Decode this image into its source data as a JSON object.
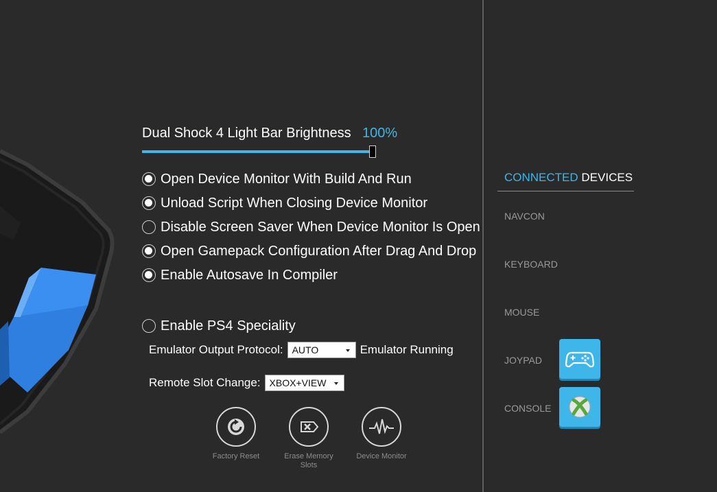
{
  "settings": {
    "brightness_label": "Dual Shock 4 Light Bar Brightness",
    "brightness_value": "100%",
    "brightness_percent": 100,
    "options": [
      {
        "label": "Open Device Monitor With Build And Run",
        "checked": true
      },
      {
        "label": "Unload Script When Closing Device Monitor",
        "checked": true
      },
      {
        "label": "Disable Screen Saver When Device Monitor Is Open",
        "checked": false
      },
      {
        "label": "Open Gamepack Configuration After Drag And Drop",
        "checked": true
      },
      {
        "label": "Enable Autosave In Compiler",
        "checked": true
      }
    ],
    "ps4_speciality": {
      "label": "Enable PS4 Speciality",
      "checked": false
    },
    "emulator_output": {
      "label": "Emulator Output Protocol:",
      "value": "AUTO",
      "status": "Emulator Running"
    },
    "remote_slot": {
      "label": "Remote Slot Change:",
      "value": "XBOX+VIEW"
    }
  },
  "actions": [
    {
      "label": "Factory Reset",
      "icon": "factory-reset-icon"
    },
    {
      "label": "Erase Memory Slots",
      "icon": "erase-memory-icon"
    },
    {
      "label": "Device Monitor",
      "icon": "device-monitor-icon"
    }
  ],
  "devices": {
    "title_accent": "CONNECTED",
    "title_rest": "DEVICES",
    "items": [
      {
        "label": "NAVCON"
      },
      {
        "label": "KEYBOARD"
      },
      {
        "label": "MOUSE"
      },
      {
        "label": "JOYPAD",
        "icon": "gamepad-icon"
      },
      {
        "label": "CONSOLE",
        "icon": "xbox-icon"
      }
    ]
  },
  "colors": {
    "background": "#2a2a2a",
    "accent": "#3fb6ea",
    "muted_text": "#9a9a9a"
  }
}
